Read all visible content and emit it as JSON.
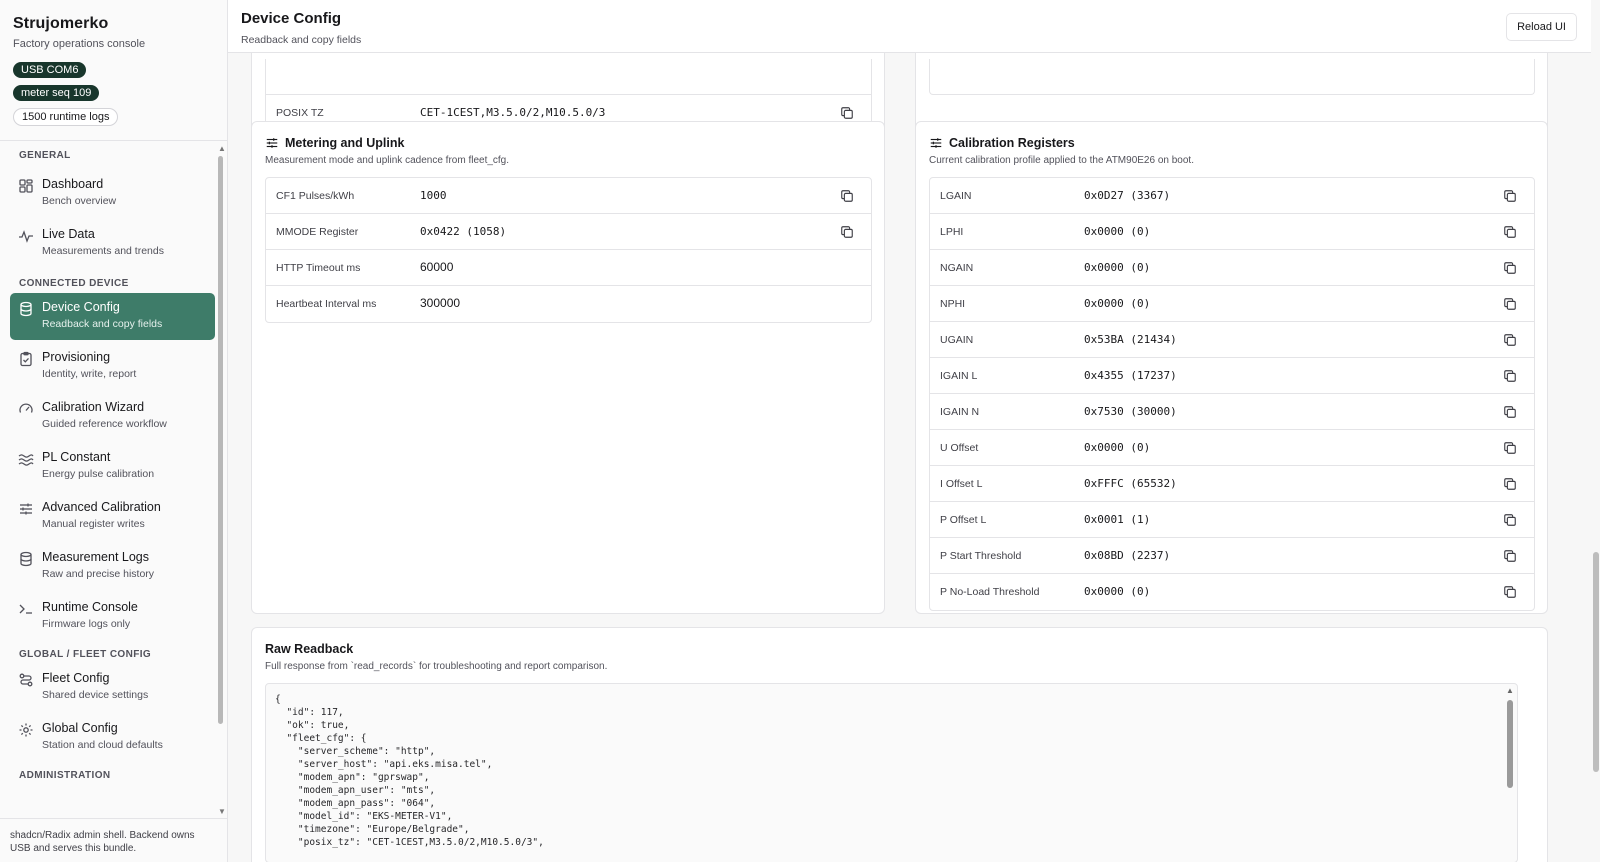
{
  "app": {
    "title": "Strujomerko",
    "subtitle": "Factory operations console"
  },
  "badges": [
    {
      "label": "USB COM6",
      "style": "dark"
    },
    {
      "label": "meter seq 109",
      "style": "dark"
    },
    {
      "label": "1500 runtime logs",
      "style": "light"
    }
  ],
  "sidebar": {
    "sections": {
      "general": "GENERAL",
      "connected": "CONNECTED DEVICE",
      "fleet": "GLOBAL / FLEET CONFIG",
      "admin": "ADMINISTRATION"
    },
    "items": [
      {
        "label": "Dashboard",
        "sub": "Bench overview",
        "icon": "grid-icon"
      },
      {
        "label": "Live Data",
        "sub": "Measurements and trends",
        "icon": "activity-icon"
      },
      {
        "label": "Device Config",
        "sub": "Readback and copy fields",
        "icon": "database-icon"
      },
      {
        "label": "Provisioning",
        "sub": "Identity, write, report",
        "icon": "clipboard-check-icon"
      },
      {
        "label": "Calibration Wizard",
        "sub": "Guided reference workflow",
        "icon": "gauge-icon"
      },
      {
        "label": "PL Constant",
        "sub": "Energy pulse calibration",
        "icon": "waves-icon"
      },
      {
        "label": "Advanced Calibration",
        "sub": "Manual register writes",
        "icon": "sliders-icon"
      },
      {
        "label": "Measurement Logs",
        "sub": "Raw and precise history",
        "icon": "database-icon"
      },
      {
        "label": "Runtime Console",
        "sub": "Firmware logs only",
        "icon": "terminal-icon"
      },
      {
        "label": "Fleet Config",
        "sub": "Shared device settings",
        "icon": "route-icon"
      },
      {
        "label": "Global Config",
        "sub": "Station and cloud defaults",
        "icon": "gear-icon"
      }
    ],
    "footer": "shadcn/Radix admin shell. Backend owns USB and serves this bundle."
  },
  "header": {
    "title": "Device Config",
    "subtitle": "Readback and copy fields",
    "reload_label": "Reload UI"
  },
  "top_partial": {
    "label": "POSIX TZ",
    "value": "CET-1CEST,M3.5.0/2,M10.5.0/3"
  },
  "metering": {
    "title": "Metering and Uplink",
    "subtitle": "Measurement mode and uplink cadence from fleet_cfg.",
    "rows": [
      {
        "label": "CF1 Pulses/kWh",
        "value": "1000"
      },
      {
        "label": "MMODE Register",
        "value": "0x0422 (1058)"
      },
      {
        "label": "HTTP Timeout ms",
        "value": "60000"
      },
      {
        "label": "Heartbeat Interval ms",
        "value": "300000"
      }
    ]
  },
  "calibration": {
    "title": "Calibration Registers",
    "subtitle": "Current calibration profile applied to the ATM90E26 on boot.",
    "rows": [
      {
        "label": "LGAIN",
        "value": "0x0D27 (3367)"
      },
      {
        "label": "LPHI",
        "value": "0x0000 (0)"
      },
      {
        "label": "NGAIN",
        "value": "0x0000 (0)"
      },
      {
        "label": "NPHI",
        "value": "0x0000 (0)"
      },
      {
        "label": "UGAIN",
        "value": "0x53BA (21434)"
      },
      {
        "label": "IGAIN L",
        "value": "0x4355 (17237)"
      },
      {
        "label": "IGAIN N",
        "value": "0x7530 (30000)"
      },
      {
        "label": "U Offset",
        "value": "0x0000 (0)"
      },
      {
        "label": "I Offset L",
        "value": "0xFFFC (65532)"
      },
      {
        "label": "P Offset L",
        "value": "0x0001 (1)"
      },
      {
        "label": "P Start Threshold",
        "value": "0x08BD (2237)"
      },
      {
        "label": "P No-Load Threshold",
        "value": "0x0000 (0)"
      }
    ]
  },
  "raw": {
    "title": "Raw Readback",
    "subtitle": "Full response from `read_records` for troubleshooting and report comparison.",
    "json_text": "{\n  \"id\": 117,\n  \"ok\": true,\n  \"fleet_cfg\": {\n    \"server_scheme\": \"http\",\n    \"server_host\": \"api.eks.misa.tel\",\n    \"modem_apn\": \"gprswap\",\n    \"modem_apn_user\": \"mts\",\n    \"modem_apn_pass\": \"064\",\n    \"model_id\": \"EKS-METER-V1\",\n    \"timezone\": \"Europe/Belgrade\",\n    \"posix_tz\": \"CET-1CEST,M3.5.0/2,M10.5.0/3\","
  }
}
